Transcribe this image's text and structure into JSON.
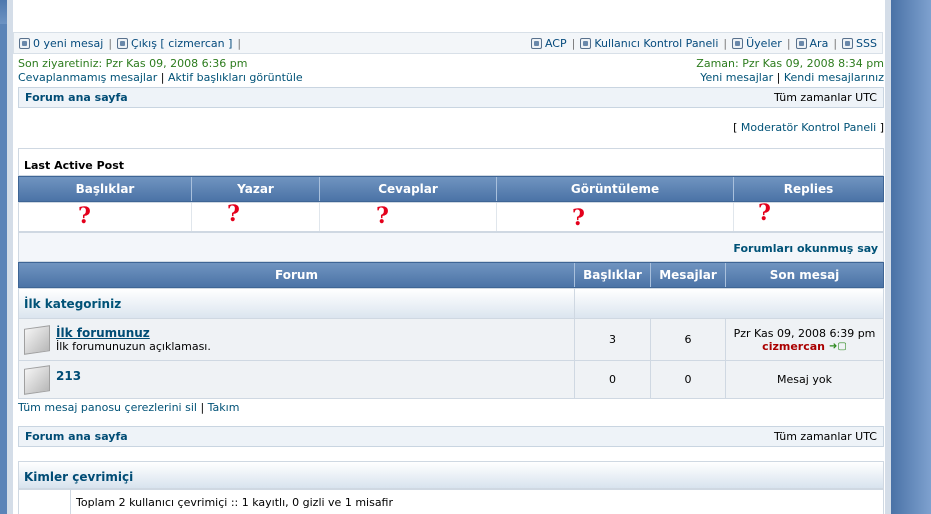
{
  "topbar": {
    "new_messages": "0 yeni mesaj",
    "logout": "Çıkış [ cizmercan ]",
    "acp": "ACP",
    "ucp": "Kullanıcı Kontrol Paneli",
    "members": "Üyeler",
    "search": "Ara",
    "faq": "SSS"
  },
  "info": {
    "last_visit": "Son ziyaretiniz: Pzr Kas 09, 2008 6:36 pm",
    "current_time": "Zaman: Pzr Kas 09, 2008 8:34 pm",
    "unanswered": "Cevaplanmamış mesajlar",
    "active_topics": "Aktif başlıkları görüntüle",
    "new_posts": "Yeni mesajlar",
    "own_posts": "Kendi mesajlarınız",
    "sep": "|"
  },
  "nav": {
    "home": "Forum ana sayfa",
    "timezone": "Tüm zamanlar UTC"
  },
  "mcp": {
    "open": "[",
    "label": "Moderatör Kontrol Paneli",
    "close": "]"
  },
  "last_active": {
    "title": "Last Active Post",
    "headers": [
      "Başlıklar",
      "Yazar",
      "Cevaplar",
      "Görüntüleme",
      "Replies"
    ],
    "placeholder": "?"
  },
  "mark_read": "Forumları okunmuş say",
  "forum_table": {
    "headers": [
      "Forum",
      "Başlıklar",
      "Mesajlar",
      "Son mesaj"
    ],
    "category": "İlk kategoriniz",
    "forums": [
      {
        "title": "İlk forumunuz",
        "desc": "İlk forumunuzun açıklaması.",
        "topics": "3",
        "posts": "6",
        "last_date": "Pzr Kas 09, 2008 6:39 pm",
        "last_user": "cizmercan"
      },
      {
        "title": "213",
        "desc": "",
        "topics": "0",
        "posts": "0",
        "last_date": "Mesaj yok",
        "last_user": ""
      }
    ]
  },
  "footer_links": {
    "delete_cookies": "Tüm mesaj panosu çerezlerini sil",
    "team": "Takım"
  },
  "who": {
    "title": "Kimler çevrimiçi",
    "line1": "Toplam 2 kullanıcı çevrimiçi :: 1 kayıtlı, 0 gizli ve 1 misafir"
  },
  "colors": {
    "header_bg": "#4b73a6",
    "last_user": "#aa0000",
    "annotation_red": "#e4001b"
  }
}
